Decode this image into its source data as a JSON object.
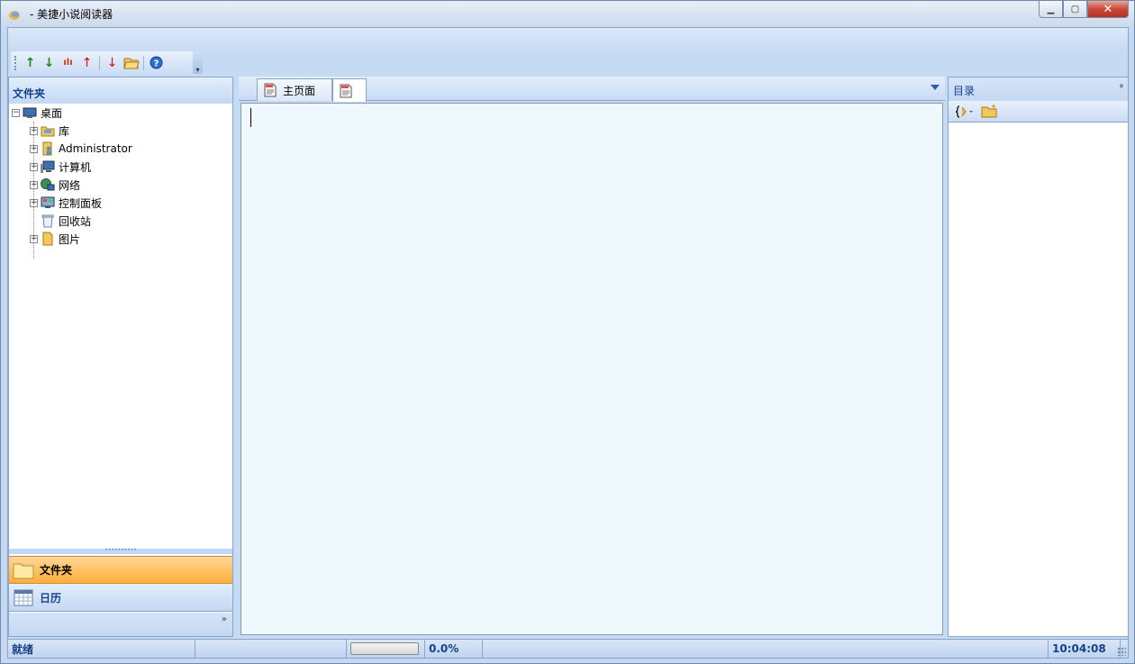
{
  "window": {
    "title": "- 美捷小说阅读器",
    "minimize_symbol": "▁",
    "maximize_symbol": "▢",
    "close_symbol": "✕"
  },
  "toolbar": {
    "buttons": [
      {
        "name": "move-up-icon",
        "glyph": "↑",
        "color": "#1a8a1a"
      },
      {
        "name": "move-down-icon",
        "glyph": "↓",
        "color": "#1a8a1a"
      },
      {
        "name": "chart-icon",
        "glyph": "ılı",
        "color": "#cc3322"
      },
      {
        "name": "prev-icon",
        "glyph": "↑",
        "color": "#d01010"
      },
      {
        "name": "next-icon",
        "glyph": "↓",
        "color": "#d01010"
      },
      {
        "name": "open-folder-icon",
        "glyph": "📂",
        "color": "#d9a526"
      },
      {
        "name": "help-icon",
        "glyph": "?",
        "color": "#1f56b8"
      }
    ],
    "more_symbol": "▾"
  },
  "folders_panel": {
    "title": "文件夹",
    "tree": [
      {
        "label": "桌面",
        "icon": "desktop-icon",
        "expander": "−",
        "level": 0
      },
      {
        "label": "库",
        "icon": "library-icon",
        "expander": "+",
        "level": 1
      },
      {
        "label": "Administrator",
        "icon": "user-folder-icon",
        "expander": "+",
        "level": 1
      },
      {
        "label": "计算机",
        "icon": "computer-icon",
        "expander": "+",
        "level": 1
      },
      {
        "label": "网络",
        "icon": "network-icon",
        "expander": "+",
        "level": 1
      },
      {
        "label": "控制面板",
        "icon": "control-panel-icon",
        "expander": "+",
        "level": 1
      },
      {
        "label": "回收站",
        "icon": "recycle-bin-icon",
        "expander": "",
        "level": 1
      },
      {
        "label": "图片",
        "icon": "pictures-folder-icon",
        "expander": "+",
        "level": 1
      }
    ],
    "splitter_dots": "••••••••••",
    "nav_buttons": [
      {
        "label": "文件夹",
        "active": true
      },
      {
        "label": "日历",
        "active": false
      }
    ],
    "footer_chevrons": "»"
  },
  "tabs": [
    {
      "label": "主页面",
      "active": false
    },
    {
      "label": "",
      "active": true
    }
  ],
  "toc_panel": {
    "title": "目录",
    "pin_symbol": "ᵠ"
  },
  "status": {
    "ready": "就绪",
    "progress_percent": 0.0,
    "progress_text": "0.0%",
    "clock": "10:04:08"
  }
}
